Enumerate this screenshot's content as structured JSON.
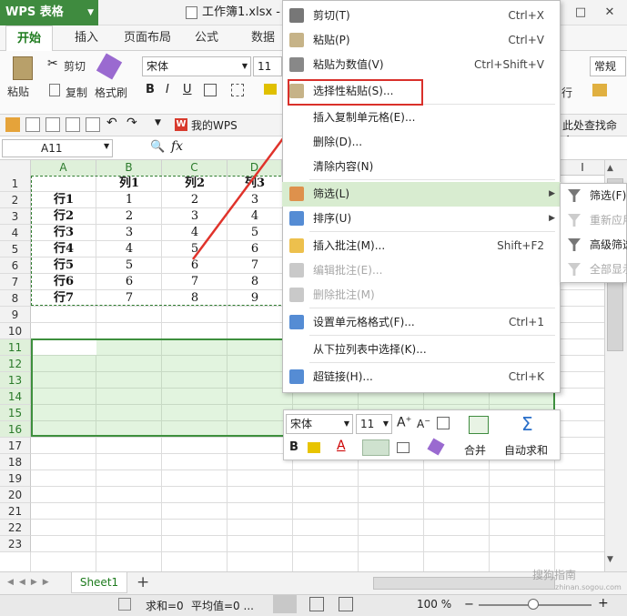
{
  "app": {
    "name": "WPS 表格",
    "doc_title": "工作簿1.xlsx - W"
  },
  "ribbon_tabs": [
    "开始",
    "插入",
    "页面布局",
    "公式",
    "数据"
  ],
  "toolbar": {
    "paste": "粘贴",
    "cut": "剪切",
    "copy": "复制",
    "format_painter": "格式刷",
    "font_name": "宋体",
    "font_size": "11",
    "number_format": "常规",
    "row_label": "行"
  },
  "qat": {
    "my_wps": "我的WPS",
    "find_cmd": "此处查找命令"
  },
  "formula_bar": {
    "name_box": "A11",
    "fx": "fx"
  },
  "columns": [
    "A",
    "B",
    "C",
    "D"
  ],
  "rows": [
    "1",
    "2",
    "3",
    "4",
    "5",
    "6",
    "7",
    "8",
    "9",
    "10",
    "11",
    "12",
    "13",
    "14",
    "15",
    "16",
    "17",
    "18",
    "19",
    "20",
    "21",
    "22",
    "23"
  ],
  "sheet": {
    "header": [
      "",
      "列1",
      "列2",
      "列3"
    ],
    "data": [
      [
        "行1",
        "1",
        "2",
        "3"
      ],
      [
        "行2",
        "2",
        "3",
        "4"
      ],
      [
        "行3",
        "3",
        "4",
        "5"
      ],
      [
        "行4",
        "4",
        "5",
        "6"
      ],
      [
        "行5",
        "5",
        "6",
        "7"
      ],
      [
        "行6",
        "6",
        "7",
        "8"
      ],
      [
        "行7",
        "7",
        "8",
        "9"
      ]
    ]
  },
  "hidden_col_letter": "I",
  "context_menu": [
    {
      "label": "剪切(T)",
      "shortcut": "Ctrl+X",
      "icon": "scissors-icon"
    },
    {
      "label": "粘贴(P)",
      "shortcut": "Ctrl+V",
      "icon": "paste-icon"
    },
    {
      "label": "粘贴为数值(V)",
      "shortcut": "Ctrl+Shift+V",
      "icon": "paste-values-icon"
    },
    {
      "label": "选择性粘贴(S)...",
      "shortcut": "",
      "icon": "paste-special-icon"
    },
    {
      "label": "插入复制单元格(E)...",
      "shortcut": "",
      "icon": ""
    },
    {
      "label": "删除(D)...",
      "shortcut": "",
      "icon": ""
    },
    {
      "label": "清除内容(N)",
      "shortcut": "",
      "icon": ""
    },
    {
      "label": "筛选(L)",
      "shortcut": "",
      "icon": "filter-icon"
    },
    {
      "label": "排序(U)",
      "shortcut": "",
      "icon": "sort-icon"
    },
    {
      "label": "插入批注(M)...",
      "shortcut": "Shift+F2",
      "icon": "comment-add-icon"
    },
    {
      "label": "编辑批注(E)...",
      "shortcut": "",
      "icon": "comment-edit-icon"
    },
    {
      "label": "删除批注(M)",
      "shortcut": "",
      "icon": "comment-delete-icon"
    },
    {
      "label": "设置单元格格式(F)...",
      "shortcut": "Ctrl+1",
      "icon": "format-cells-icon"
    },
    {
      "label": "从下拉列表中选择(K)...",
      "shortcut": "",
      "icon": ""
    },
    {
      "label": "超链接(H)...",
      "shortcut": "Ctrl+K",
      "icon": "hyperlink-icon"
    }
  ],
  "submenu": [
    {
      "label": "筛选(F)"
    },
    {
      "label": "重新应用"
    },
    {
      "label": "高级筛选"
    },
    {
      "label": "全部显示"
    }
  ],
  "mini_toolbar": {
    "font": "宋体",
    "size": "11",
    "merge": "合并",
    "autosum": "自动求和"
  },
  "sheet_tab": "Sheet1",
  "status": {
    "sum": "求和=0",
    "avg": "平均值=0 ...",
    "zoom": "100 %"
  },
  "watermark": {
    "line1": "搜狗指南",
    "line2": "zhinan.sogou.com"
  },
  "colors": {
    "brand": "#3f8b3f",
    "highlight": "#d9302a",
    "selection": "#3d8f3d"
  }
}
